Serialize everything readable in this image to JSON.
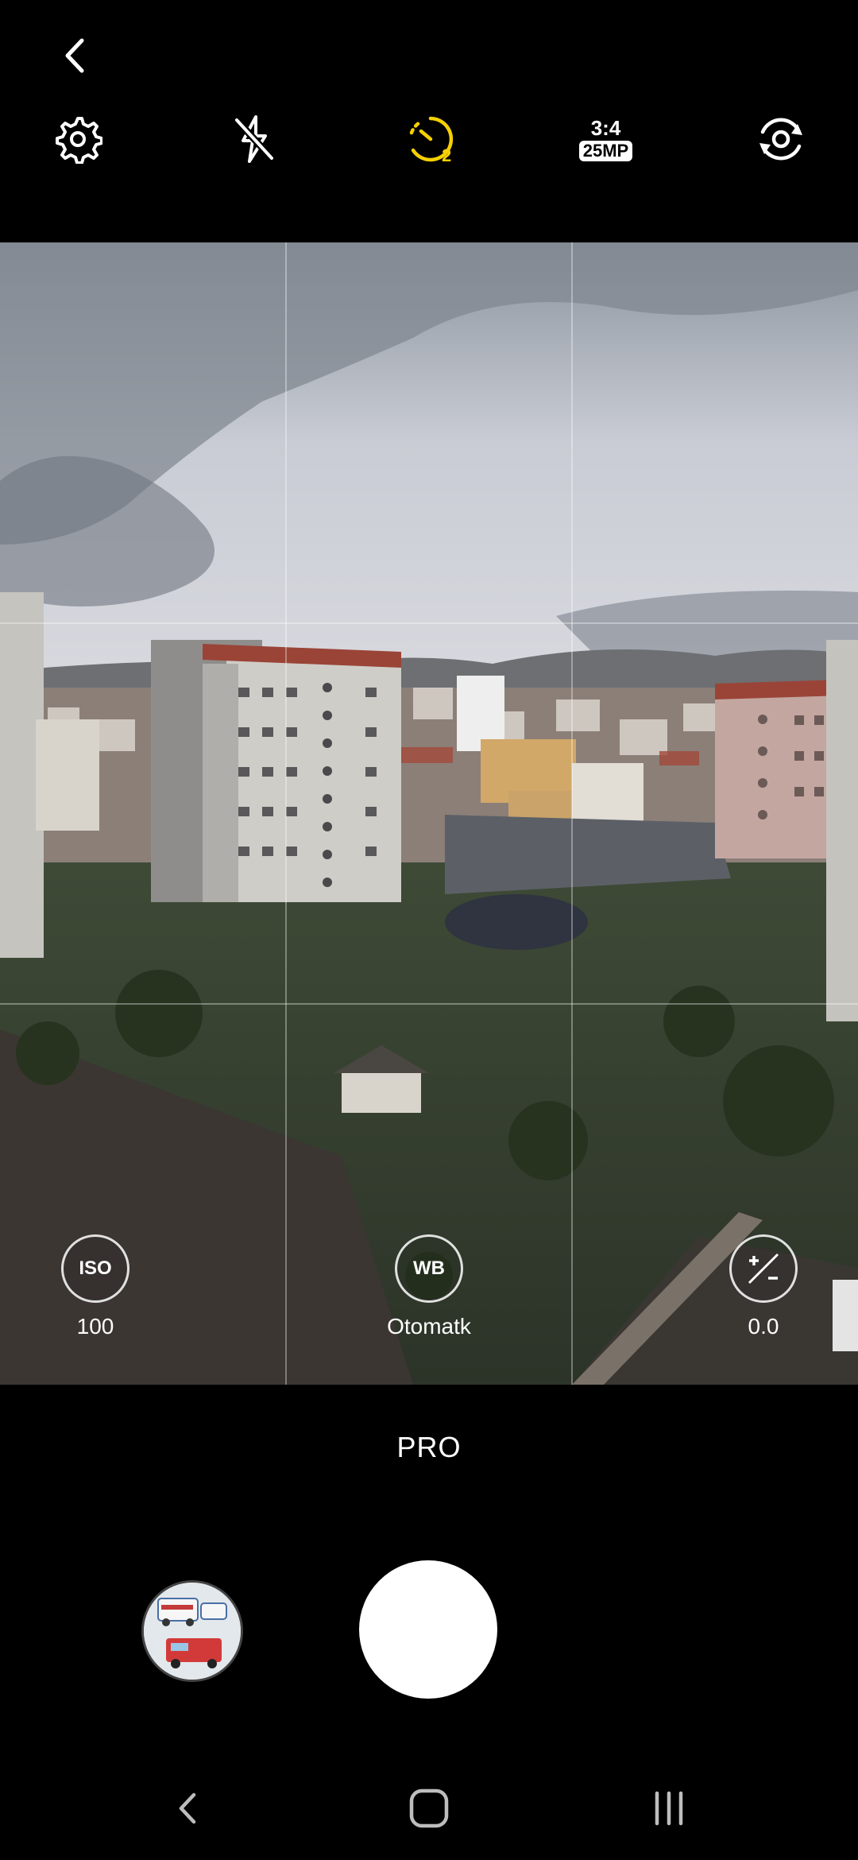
{
  "top_bar": {
    "timer_value": "2",
    "aspect_ratio": "3:4",
    "resolution": "25MP",
    "accent_color": "#f5d000"
  },
  "pro_controls": {
    "iso": {
      "label": "ISO",
      "value": "100"
    },
    "white_balance": {
      "label": "WB",
      "value": "Otomatk"
    },
    "exposure": {
      "value": "0.0"
    }
  },
  "mode": {
    "label": "PRO"
  },
  "icons": [
    "back-arrow-icon",
    "gear-icon",
    "flash-off-icon",
    "timer-icon",
    "switch-camera-icon",
    "exposure-icon",
    "nav-back-icon",
    "nav-home-icon",
    "nav-recents-icon"
  ]
}
